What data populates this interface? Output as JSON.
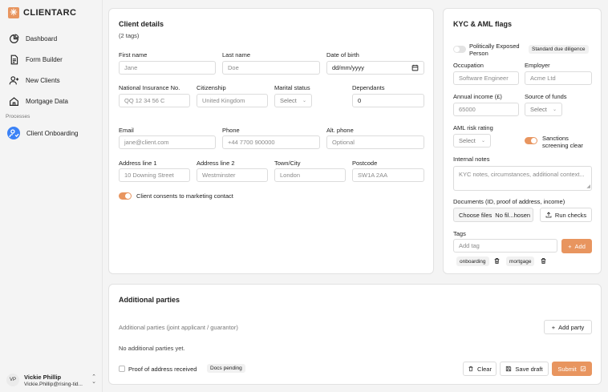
{
  "app": {
    "name": "CLIENTARC"
  },
  "sidebar": {
    "items": [
      {
        "label": "Dashboard"
      },
      {
        "label": "Form Builder"
      },
      {
        "label": "New Clients"
      },
      {
        "label": "Mortgage Data"
      }
    ],
    "section_label": "Processes",
    "process_items": [
      {
        "label": "Client Onboarding"
      }
    ]
  },
  "user": {
    "initials": "VP",
    "name": "Vickie Phillip",
    "email": "Vickie.Phillip@rising-tid..."
  },
  "client_details": {
    "title": "Client details",
    "subtitle": "(2 tags)",
    "first_name": {
      "label": "First name",
      "placeholder": "Jane"
    },
    "last_name": {
      "label": "Last name",
      "placeholder": "Doe"
    },
    "dob": {
      "label": "Date of birth",
      "placeholder": "dd/mm/yyyy"
    },
    "ni": {
      "label": "National Insurance No.",
      "placeholder": "QQ 12 34 56 C"
    },
    "citizenship": {
      "label": "Citizenship",
      "placeholder": "United Kingdom"
    },
    "marital": {
      "label": "Marital status",
      "value": "Select"
    },
    "dependants": {
      "label": "Dependants",
      "value": "0"
    },
    "email": {
      "label": "Email",
      "placeholder": "jane@client.com"
    },
    "phone": {
      "label": "Phone",
      "placeholder": "+44 7700 900000"
    },
    "alt_phone": {
      "label": "Alt. phone",
      "placeholder": "Optional"
    },
    "address1": {
      "label": "Address line 1",
      "placeholder": "10 Downing Street"
    },
    "address2": {
      "label": "Address line 2",
      "placeholder": "Westminster"
    },
    "town": {
      "label": "Town/City",
      "placeholder": "London"
    },
    "postcode": {
      "label": "Postcode",
      "placeholder": "SW1A 2AA"
    },
    "consent": {
      "label": "Client consents to marketing contact",
      "on": true
    }
  },
  "kyc": {
    "title": "KYC & AML flags",
    "pep": {
      "label": "Politically Exposed Person",
      "on": false
    },
    "sdd_badge": "Standard due diligence",
    "occupation": {
      "label": "Occupation",
      "placeholder": "Software Engineer"
    },
    "employer": {
      "label": "Employer",
      "placeholder": "Acme Ltd"
    },
    "income": {
      "label": "Annual income (£)",
      "placeholder": "65000"
    },
    "source": {
      "label": "Source of funds",
      "value": "Select"
    },
    "aml_risk": {
      "label": "AML risk rating",
      "value": "Select"
    },
    "sanctions": {
      "label": "Sanctions screening clear",
      "on": true
    },
    "notes": {
      "label": "Internal notes",
      "placeholder": "KYC notes, circumstances, additional context..."
    },
    "documents": {
      "label": "Documents (ID, proof of address, income)",
      "choose": "Choose files",
      "file_status": "No fil...hosen",
      "run_checks": "Run checks"
    },
    "tags": {
      "label": "Tags",
      "placeholder": "Add tag",
      "add": "Add",
      "items": [
        "onboarding",
        "mortgage"
      ]
    }
  },
  "parties": {
    "title": "Additional parties",
    "subtitle": "Additional parties (joint applicant / guarantor)",
    "add_party": "Add party",
    "empty": "No additional parties yet.",
    "proof": {
      "label": "Proof of address received",
      "badge": "Docs pending"
    },
    "clear": "Clear",
    "save_draft": "Save draft",
    "submit": "Submit"
  },
  "colors": {
    "accent": "#e8955f",
    "active_nav": "#3b82f6"
  }
}
